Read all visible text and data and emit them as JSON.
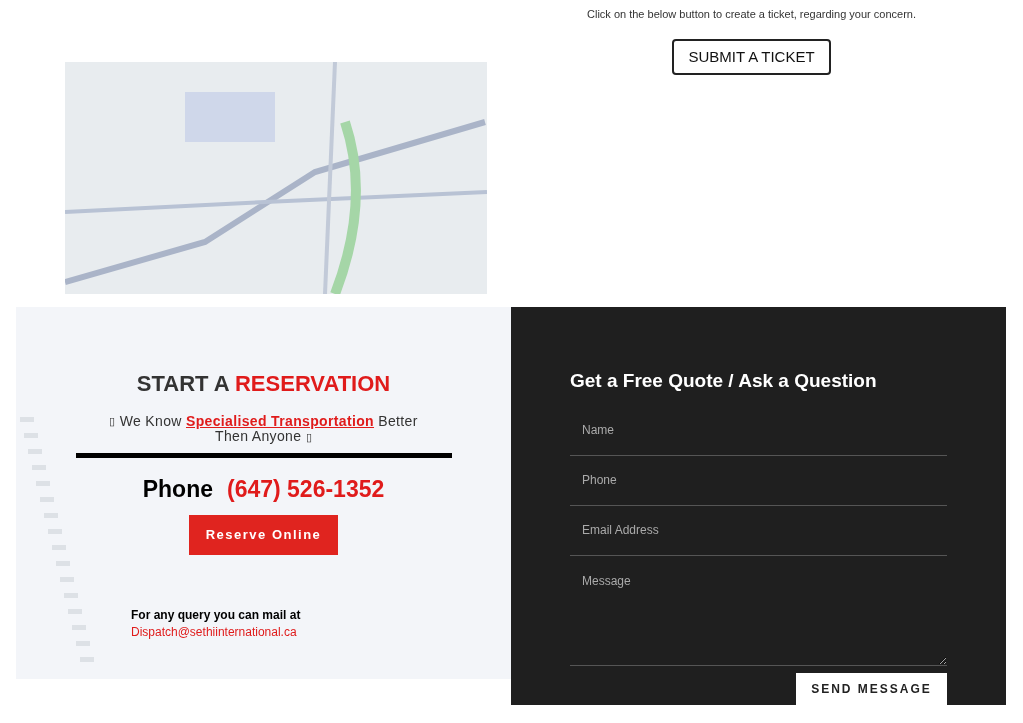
{
  "ticket": {
    "text": "Click on the below button to create a ticket, regarding your concern.",
    "button": "SUBMIT A TICKET"
  },
  "reservation": {
    "title_plain": "START A",
    "title_highlight": "RESERVATION",
    "tagline_lead_icon": "▯",
    "tagline_before": "We Know",
    "tagline_link": "Specialised Transportation",
    "tagline_after": "Better Then Anyone",
    "tagline_trail_icon": "▯",
    "phone_label": "Phone",
    "phone_number": "(647) 526-1352",
    "button": "Reserve Online",
    "mail_label": "For any query you can mail at",
    "mail_address": "Dispatch@sethiinternational.ca"
  },
  "quote_form": {
    "title": "Get a Free Quote / Ask a Question",
    "fields": [
      {
        "kind": "input",
        "placeholder": "Name"
      },
      {
        "kind": "input",
        "placeholder": "Phone"
      },
      {
        "kind": "input",
        "placeholder": "Email Address"
      },
      {
        "kind": "textarea",
        "placeholder": "Message"
      }
    ],
    "button": "SEND MESSAGE"
  }
}
